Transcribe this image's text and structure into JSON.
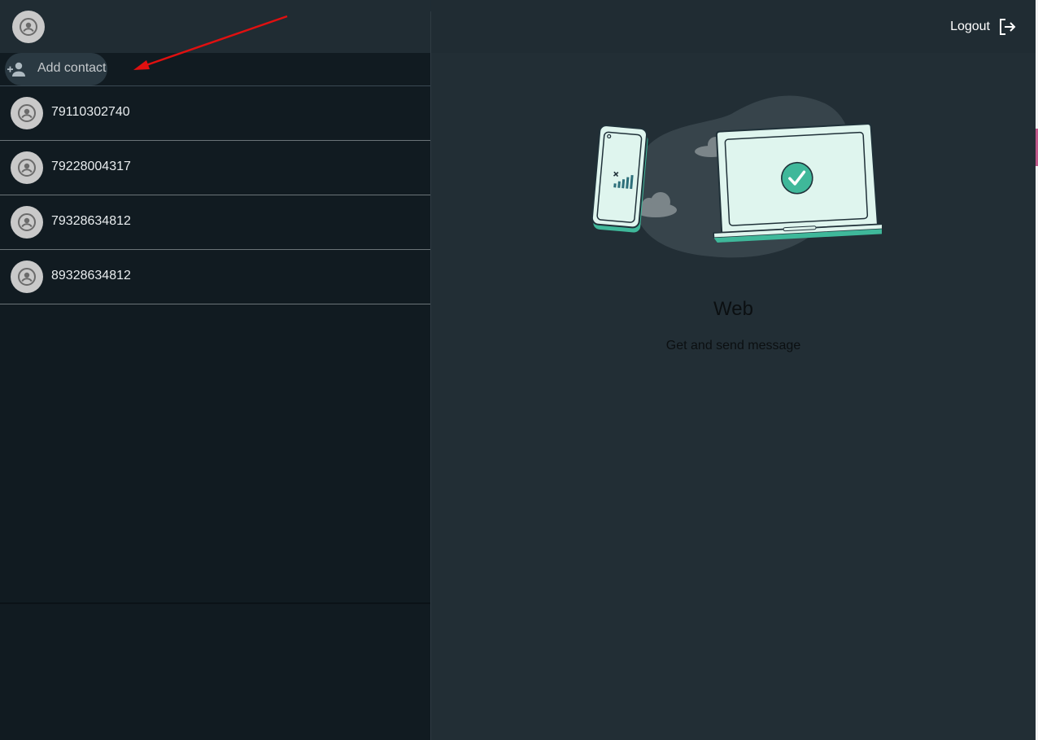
{
  "sidebar": {
    "add_contact_label": "Add contact",
    "contacts": [
      {
        "phone": "79110302740"
      },
      {
        "phone": "79228004317"
      },
      {
        "phone": "79328634812"
      },
      {
        "phone": "89328634812"
      }
    ]
  },
  "header": {
    "logout_label": "Logout"
  },
  "intro": {
    "title": "Web",
    "subtitle": "Get and send message"
  },
  "icons": {
    "avatar": "user-avatar-icon",
    "add_contact": "person-add-icon",
    "logout": "logout-icon",
    "annotation": "red-arrow"
  },
  "colors": {
    "panel_dark": "#111b21",
    "header": "#202c33",
    "main_bg": "#222e35",
    "accent_green": "#25d366",
    "annotation_red": "#e01010"
  }
}
